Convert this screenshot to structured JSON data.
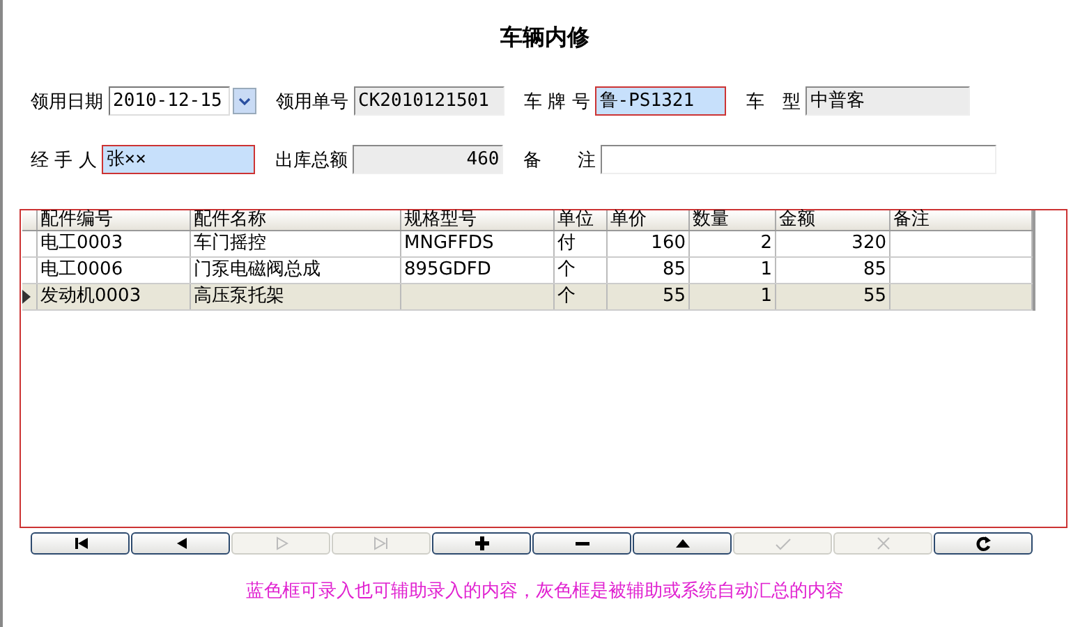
{
  "title": "车辆内修",
  "fields": [
    {
      "label": "领用日期",
      "value": "2010-12-15",
      "kind": "date"
    },
    {
      "label": "领用单号",
      "value": "CK2010121501",
      "kind": "readonly"
    },
    {
      "label": "车 牌 号",
      "value": "鲁-PS1321",
      "kind": "editable"
    },
    {
      "label": "车　型",
      "value": "中普客",
      "kind": "readonly"
    },
    {
      "label": "经 手 人",
      "value": "张××",
      "kind": "editable"
    },
    {
      "label": "出库总额",
      "value": "460",
      "kind": "readonly-number"
    },
    {
      "label": "备　　注",
      "kind": "plain"
    }
  ],
  "table": {
    "columns": [
      {
        "label": "配件编号",
        "kind": "text"
      },
      {
        "label": "配件名称",
        "kind": "text"
      },
      {
        "label": "规格型号",
        "kind": "text"
      },
      {
        "label": "单位",
        "kind": "text"
      },
      {
        "label": "单价",
        "kind": "number"
      },
      {
        "label": "数量",
        "kind": "number"
      },
      {
        "label": "金额",
        "kind": "number"
      },
      {
        "label": "备注",
        "kind": "text"
      }
    ],
    "rows": [
      {
        "selected": false,
        "cells": [
          "电工0003",
          "车门摇控",
          "MNGFFDS",
          "付",
          "160",
          "2",
          "320",
          null
        ]
      },
      {
        "selected": false,
        "cells": [
          "电工0006",
          "门泵电磁阀总成",
          "895GDFD",
          "个",
          "85",
          "1",
          "85",
          null
        ]
      },
      {
        "selected": true,
        "cells": [
          "发动机0003",
          "高压泵托架",
          null,
          "个",
          "55",
          "1",
          "55",
          null
        ]
      }
    ]
  },
  "buttons": [
    {
      "kind": "first",
      "disabled": false
    },
    {
      "kind": "prev",
      "disabled": false
    },
    {
      "kind": "next",
      "disabled": true
    },
    {
      "kind": "last",
      "disabled": true
    },
    {
      "kind": "add",
      "disabled": false
    },
    {
      "kind": "delete",
      "disabled": false
    },
    {
      "kind": "edit",
      "disabled": false
    },
    {
      "kind": "save",
      "disabled": true
    },
    {
      "kind": "cancel",
      "disabled": true
    },
    {
      "kind": "refresh",
      "disabled": false
    }
  ],
  "hint": "蓝色框可录入也可辅助录入的内容，灰色框是被辅助或系统自动汇总的内容"
}
